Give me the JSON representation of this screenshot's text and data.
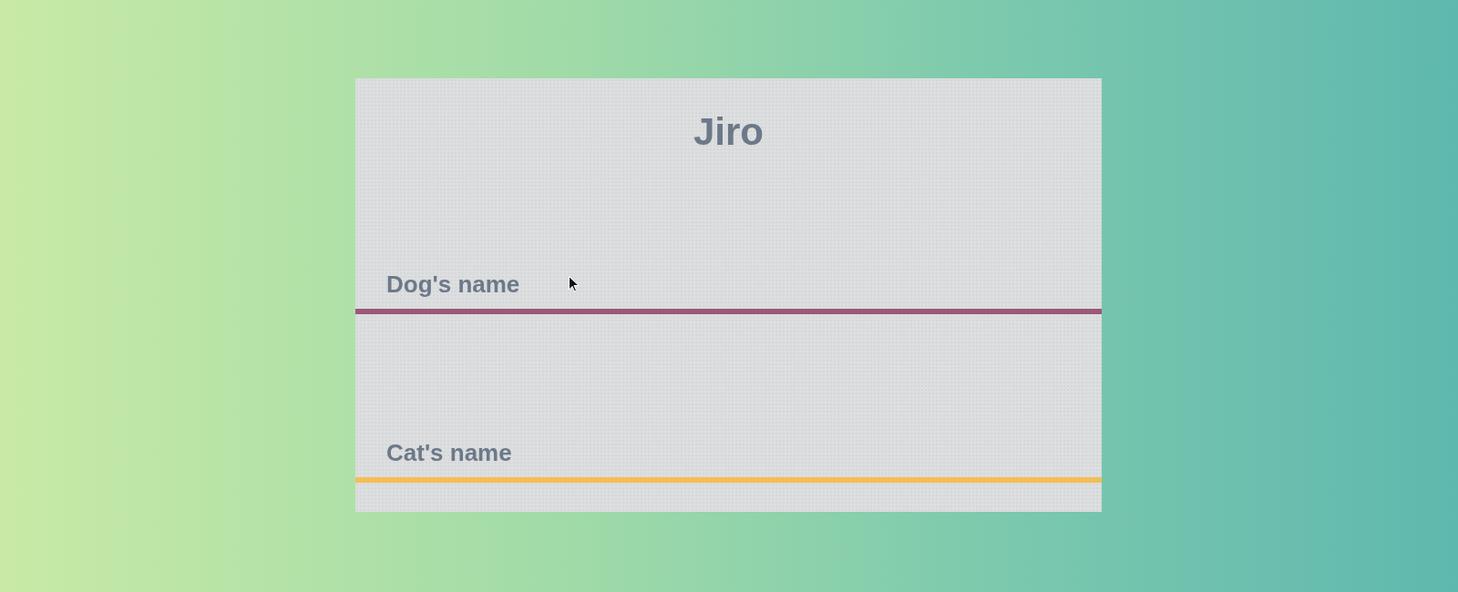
{
  "title": "Jiro",
  "fields": [
    {
      "placeholder": "Dog's name",
      "color": "#9c5877"
    },
    {
      "placeholder": "Cat's name",
      "color": "#f4bd55"
    }
  ]
}
